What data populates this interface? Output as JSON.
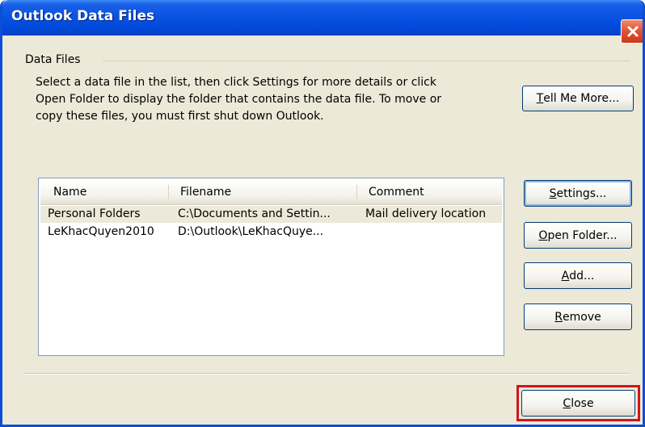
{
  "window": {
    "title": "Outlook Data Files"
  },
  "group": {
    "label": "Data Files"
  },
  "description": {
    "lines": [
      "Select a data file in the list, then click Settings for more details or click",
      "Open Folder to display the folder that contains the data file. To move or",
      "copy these files, you must first shut down Outlook."
    ]
  },
  "buttons": {
    "tell_me_more": {
      "accel": "T",
      "rest": "ell Me More..."
    },
    "settings": {
      "accel": "S",
      "rest": "ettings..."
    },
    "open_folder": {
      "accel": "O",
      "rest": "pen Folder..."
    },
    "add": {
      "accel": "A",
      "rest": "dd..."
    },
    "remove": {
      "accel": "R",
      "rest": "emove"
    },
    "close": {
      "accel": "C",
      "rest": "lose"
    }
  },
  "list": {
    "columns": [
      "Name",
      "Filename",
      "Comment"
    ],
    "rows": [
      {
        "name": "Personal Folders",
        "filename": "C:\\Documents and Settin...",
        "comment": "Mail delivery location",
        "selected": true
      },
      {
        "name": "LeKhacQuyen2010",
        "filename": "D:\\Outlook\\LeKhacQuye...",
        "comment": "",
        "selected": false
      }
    ]
  },
  "colors": {
    "titlebar": "#0a54e3",
    "dialog_bg": "#ece9d8",
    "close_highlight": "#d0141c"
  },
  "icons": {
    "title_close": "close-icon"
  }
}
